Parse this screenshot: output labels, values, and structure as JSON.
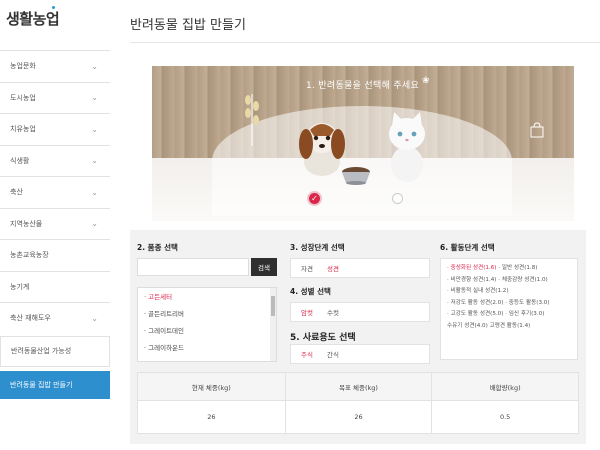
{
  "sidebar": {
    "logo": "생활농업",
    "items": [
      {
        "label": "농업문화",
        "chevron": true
      },
      {
        "label": "도시농업",
        "chevron": true
      },
      {
        "label": "치유농업",
        "chevron": true
      },
      {
        "label": "식생활",
        "chevron": true
      },
      {
        "label": "축산",
        "chevron": true
      },
      {
        "label": "지역농산물",
        "chevron": true
      },
      {
        "label": "농촌교육농장",
        "chevron": false
      },
      {
        "label": "농기계",
        "chevron": false
      },
      {
        "label": "축산 재해도우",
        "chevron": true
      },
      {
        "label": "반려동물산업 가능성",
        "chevron": false
      },
      {
        "label": "반려동물 집밥 만들기",
        "chevron": false
      }
    ]
  },
  "page": {
    "title": "반려동물 집밥 만들기"
  },
  "banner": {
    "title": "1. 반려동물을 선택해 주세요"
  },
  "form": {
    "breed": {
      "title": "2. 품종 선택",
      "search_button": "검색",
      "items": [
        "고든세터",
        "골든리트리버",
        "그레이트데인",
        "그레이하운드"
      ],
      "selected_index": 0
    },
    "growth": {
      "title": "3. 성장단계 선택",
      "options": [
        "자견",
        "성견"
      ],
      "selected_index": 1
    },
    "sex": {
      "title": "4. 성별 선택",
      "options": [
        "암컷",
        "수컷"
      ],
      "selected_index": 0
    },
    "purpose": {
      "title": "5. 사료용도 선택",
      "options": [
        "주식",
        "간식"
      ],
      "selected_index": 0
    },
    "activity": {
      "title": "6. 활동단계 선택",
      "lines": [
        [
          {
            "text": "중성화된 성견(1.6)",
            "on": true
          },
          {
            "text": "일반 성견(1.8)",
            "on": false
          }
        ],
        [
          {
            "text": "비만경향 성견(1.4)",
            "on": false
          },
          {
            "text": "체중감량 성견(1.0)",
            "on": false
          }
        ],
        [
          {
            "text": "비활동적 실내 성견(1.2)",
            "on": false
          }
        ],
        [
          {
            "text": "저강도 활동 성견(2.0)",
            "on": false
          },
          {
            "text": "중등도 활동(3.0)",
            "on": false
          }
        ],
        [
          {
            "text": "고강도 활동 성견(5.0)",
            "on": false
          },
          {
            "text": "임신 후기(3.0)",
            "on": false
          }
        ],
        [
          {
            "text": "수유기 성견(4.0)",
            "on": false
          },
          {
            "text": "고령견 활동(1.4)",
            "on": false
          }
        ]
      ]
    },
    "results": {
      "headers": [
        "현재 체중(kg)",
        "목표 체중(kg)",
        "배합량(kg)"
      ],
      "values": [
        "26",
        "26",
        "0.5"
      ]
    }
  }
}
